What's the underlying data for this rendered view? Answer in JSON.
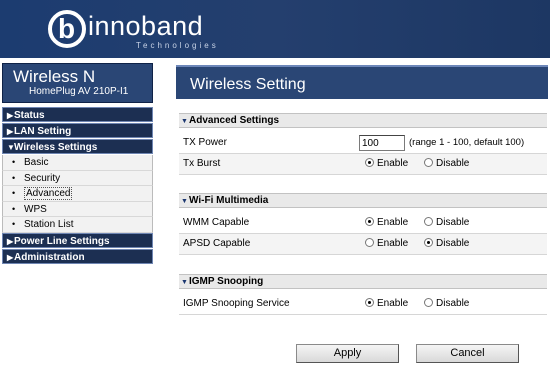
{
  "header": {
    "logo_glyph": "b",
    "brand": "innoband",
    "tagline": "Technologies"
  },
  "product": {
    "title": "Wireless N",
    "model": "HomePlug AV 210P-I1"
  },
  "nav": {
    "status": "Status",
    "lan": "LAN Setting",
    "wireless": "Wireless Settings",
    "wireless_items": [
      "Basic",
      "Security",
      "Advanced",
      "WPS",
      "Station List"
    ],
    "powerline": "Power Line Settings",
    "admin": "Administration"
  },
  "page": {
    "title": "Wireless Setting"
  },
  "advanced": {
    "header": "Advanced Settings",
    "tx_power_label": "TX Power",
    "tx_power_value": "100",
    "tx_power_hint": "(range 1 - 100, default 100)",
    "tx_burst_label": "Tx Burst",
    "tx_burst_selected": "Enable"
  },
  "wmm": {
    "header": "Wi-Fi Multimedia",
    "wmm_label": "WMM Capable",
    "wmm_selected": "Enable",
    "apsd_label": "APSD Capable",
    "apsd_selected": "Disable"
  },
  "igmp": {
    "header": "IGMP Snooping",
    "service_label": "IGMP Snooping Service",
    "service_selected": "Enable"
  },
  "options": {
    "enable": "Enable",
    "disable": "Disable"
  },
  "buttons": {
    "apply": "Apply",
    "cancel": "Cancel"
  },
  "colors": {
    "header_bg": "#1f3a6b",
    "panel_title_bg": "#2a4675",
    "nav_cat_bg": "#1c2f52"
  }
}
